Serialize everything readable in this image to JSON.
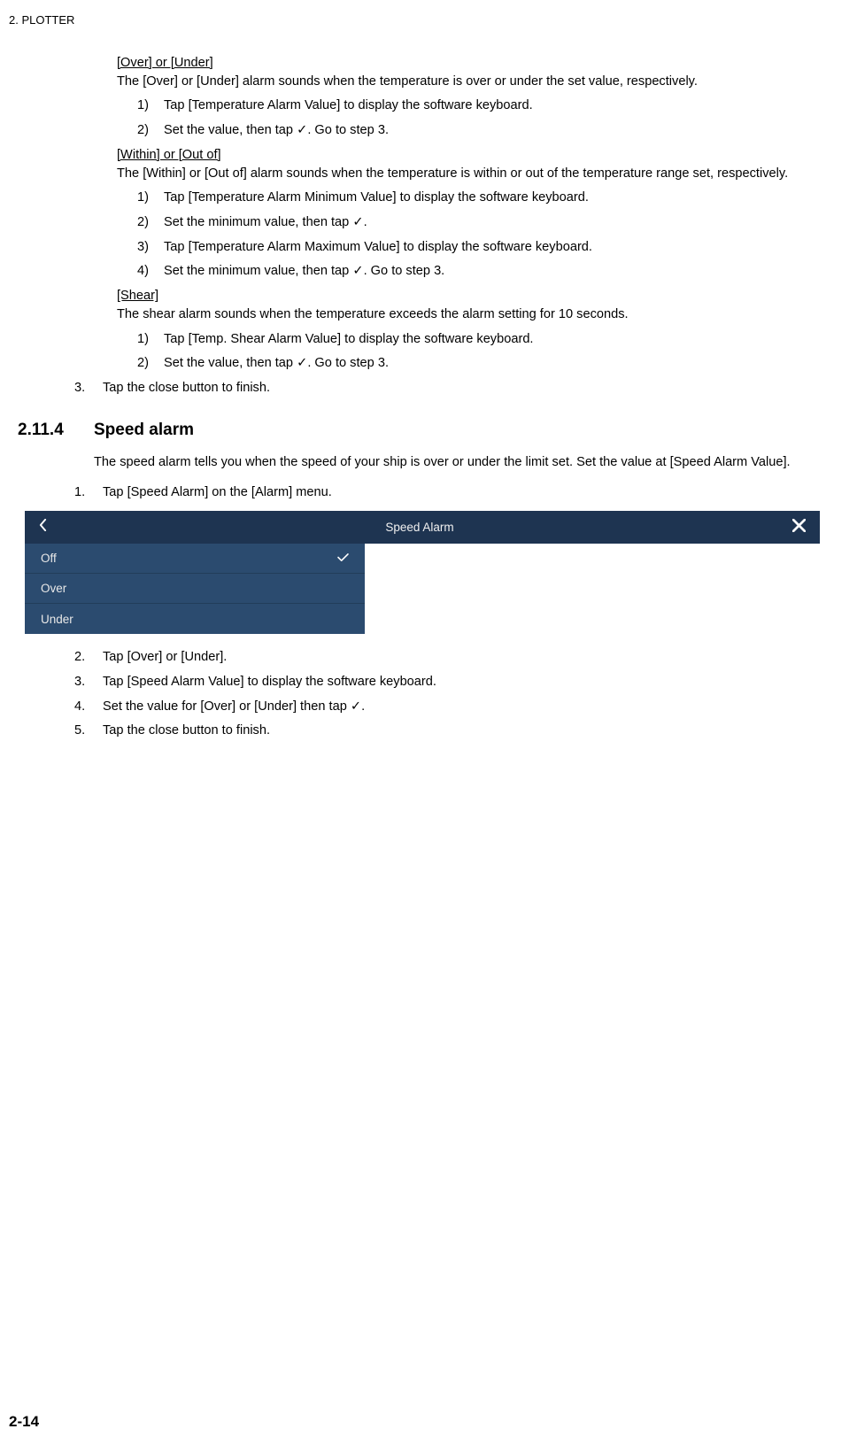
{
  "header": "2.  PLOTTER",
  "blockA": {
    "subhead": "[Over] or [Under]",
    "para": "The [Over] or [Under] alarm sounds when the temperature is over or under the set value, respectively.",
    "steps": [
      "Tap [Temperature Alarm Value] to display the software keyboard.",
      "Set the value, then tap ✓. Go to step 3."
    ]
  },
  "blockB": {
    "subhead": "[Within] or [Out of]",
    "para": "The [Within] or [Out of] alarm sounds when the temperature is within or out of the temperature range set, respectively.",
    "steps": [
      "Tap [Temperature Alarm Minimum Value] to display the software keyboard.",
      "Set the minimum value, then tap ✓.",
      "Tap [Temperature Alarm Maximum Value] to display the software keyboard.",
      "Set the minimum value, then tap ✓. Go to step 3."
    ]
  },
  "blockC": {
    "subhead": "[Shear]",
    "para": "The shear alarm sounds when the temperature exceeds the alarm setting for 10 seconds.",
    "steps": [
      "Tap [Temp. Shear Alarm Value] to display the software keyboard.",
      "Set the value, then tap ✓. Go to step 3."
    ]
  },
  "step3": "Tap the close button to finish.",
  "section": {
    "num": "2.11.4",
    "title": "Speed alarm",
    "intro": "The speed alarm tells you when the speed of your ship is over or under the limit set. Set the value at [Speed Alarm Value].",
    "step1": "Tap [Speed Alarm] on the [Alarm] menu."
  },
  "screenshot": {
    "title": "Speed Alarm",
    "options": [
      "Off",
      "Over",
      "Under"
    ],
    "selectedIndex": 0
  },
  "afterSteps": [
    "Tap [Over] or [Under].",
    "Tap [Speed Alarm Value] to display the software keyboard.",
    "Set the value for [Over] or [Under] then tap ✓.",
    "Tap the close button to finish."
  ],
  "pageNumber": "2-14"
}
